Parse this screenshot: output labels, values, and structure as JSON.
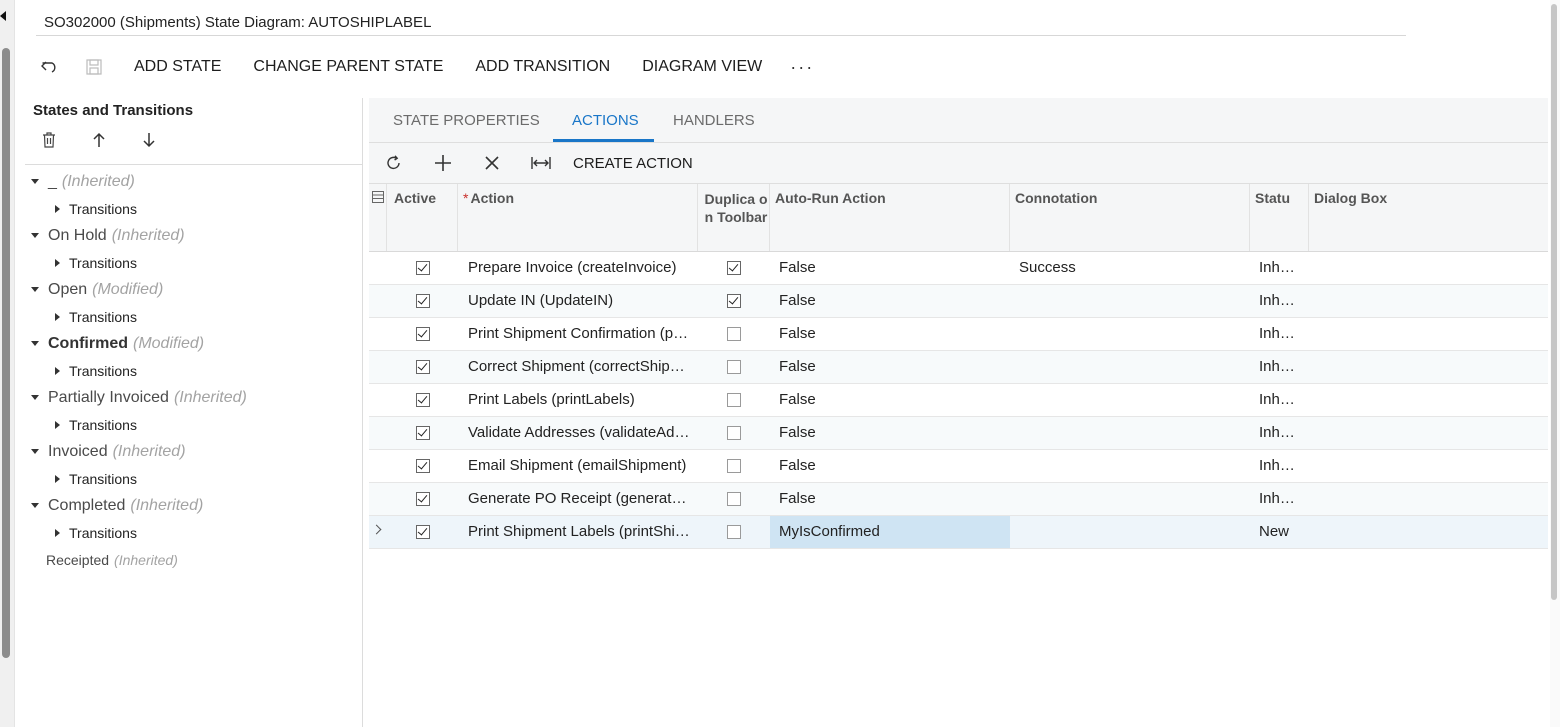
{
  "window": {
    "title": "SO302000 (Shipments) State Diagram: AUTOSHIPLABEL"
  },
  "toolbar": {
    "undo_icon": "undo-icon",
    "save_icon": "save-icon",
    "buttons": [
      "ADD STATE",
      "CHANGE PARENT STATE",
      "ADD TRANSITION",
      "DIAGRAM VIEW"
    ],
    "more": "···"
  },
  "left_panel": {
    "title": "States and Transitions",
    "tools": [
      "delete-icon",
      "arrow-up-icon",
      "arrow-down-icon"
    ],
    "states": [
      {
        "name": "_",
        "status": "(Inherited)",
        "bold": false,
        "transitions_label": "Transitions"
      },
      {
        "name": "On Hold",
        "status": "(Inherited)",
        "bold": false,
        "transitions_label": "Transitions"
      },
      {
        "name": "Open",
        "status": "(Modified)",
        "bold": false,
        "transitions_label": "Transitions"
      },
      {
        "name": "Confirmed",
        "status": "(Modified)",
        "bold": true,
        "transitions_label": "Transitions"
      },
      {
        "name": "Partially Invoiced",
        "status": "(Inherited)",
        "bold": false,
        "transitions_label": "Transitions"
      },
      {
        "name": "Invoiced",
        "status": "(Inherited)",
        "bold": false,
        "transitions_label": "Transitions"
      },
      {
        "name": "Completed",
        "status": "(Inherited)",
        "bold": false,
        "transitions_label": "Transitions"
      },
      {
        "name": "Receipted",
        "status": "(Inherited)",
        "bold": false,
        "transitions_label": ""
      }
    ]
  },
  "tabs": [
    {
      "label": "STATE PROPERTIES",
      "active": false
    },
    {
      "label": "ACTIONS",
      "active": true
    },
    {
      "label": "HANDLERS",
      "active": false
    }
  ],
  "grid_toolbar": {
    "icons": [
      "refresh-icon",
      "add-icon",
      "delete-icon",
      "fit-width-icon"
    ],
    "create_action": "CREATE ACTION"
  },
  "grid": {
    "columns": {
      "active": "Active",
      "action": "Action",
      "duplicate": "Duplica on Toolbar",
      "autorun": "Auto-Run Action",
      "connotation": "Connotation",
      "status": "Statu",
      "dialog": "Dialog Box"
    },
    "rows": [
      {
        "active": true,
        "action": "Prepare Invoice (createInvoice)",
        "duplicate": true,
        "autorun": "False",
        "connotation": "Success",
        "status": "Inh…",
        "dialog": ""
      },
      {
        "active": true,
        "action": "Update IN (UpdateIN)",
        "duplicate": true,
        "autorun": "False",
        "connotation": "",
        "status": "Inh…",
        "dialog": ""
      },
      {
        "active": true,
        "action": "Print Shipment Confirmation (pr…",
        "duplicate": false,
        "autorun": "False",
        "connotation": "",
        "status": "Inh…",
        "dialog": ""
      },
      {
        "active": true,
        "action": "Correct Shipment (correctShip…",
        "duplicate": false,
        "autorun": "False",
        "connotation": "",
        "status": "Inh…",
        "dialog": ""
      },
      {
        "active": true,
        "action": "Print Labels (printLabels)",
        "duplicate": false,
        "autorun": "False",
        "connotation": "",
        "status": "Inh…",
        "dialog": ""
      },
      {
        "active": true,
        "action": "Validate Addresses (validateAd…",
        "duplicate": false,
        "autorun": "False",
        "connotation": "",
        "status": "Inh…",
        "dialog": ""
      },
      {
        "active": true,
        "action": "Email Shipment (emailShipment)",
        "duplicate": false,
        "autorun": "False",
        "connotation": "",
        "status": "Inh…",
        "dialog": ""
      },
      {
        "active": true,
        "action": "Generate PO Receipt (generat…",
        "duplicate": false,
        "autorun": "False",
        "connotation": "",
        "status": "Inh…",
        "dialog": ""
      },
      {
        "active": true,
        "action": "Print Shipment Labels (printShi…",
        "duplicate": false,
        "autorun": "MyIsConfirmed",
        "connotation": "",
        "status": "New",
        "dialog": "",
        "selected": true
      }
    ]
  }
}
